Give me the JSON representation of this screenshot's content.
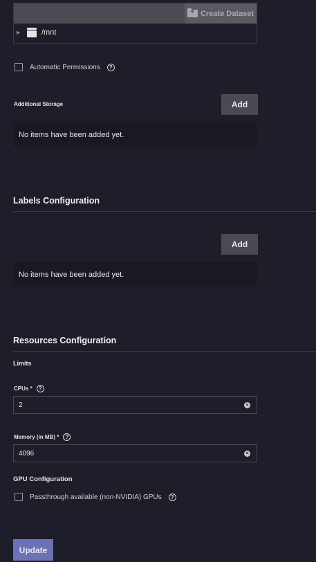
{
  "explorer": {
    "create_dataset_label": "Create Dataset",
    "path": "/mnt"
  },
  "automatic_permissions": {
    "label": "Automatic Permissions",
    "checked": false
  },
  "additional_storage": {
    "label": "Additional Storage",
    "add_label": "Add",
    "empty_text": "No items have been added yet."
  },
  "labels_configuration": {
    "title": "Labels Configuration",
    "add_label": "Add",
    "empty_text": "No items have been added yet."
  },
  "resources_configuration": {
    "title": "Resources Configuration",
    "limits_label": "Limits",
    "cpus": {
      "label": "CPUs",
      "required_mark": "*",
      "value": "2"
    },
    "memory": {
      "label": "Memory (in MB)",
      "required_mark": "*",
      "value": "4096"
    }
  },
  "gpu_configuration": {
    "title": "GPU Configuration",
    "passthrough_label": "Passthrough available (non-NVIDIA) GPUs",
    "checked": false
  },
  "update_label": "Update",
  "icons": {
    "create_dataset": "folder-plus-icon",
    "drive": "drive-icon",
    "help": "help-circle-icon",
    "clear": "clear-circle-icon",
    "caret": "caret-right-icon"
  }
}
